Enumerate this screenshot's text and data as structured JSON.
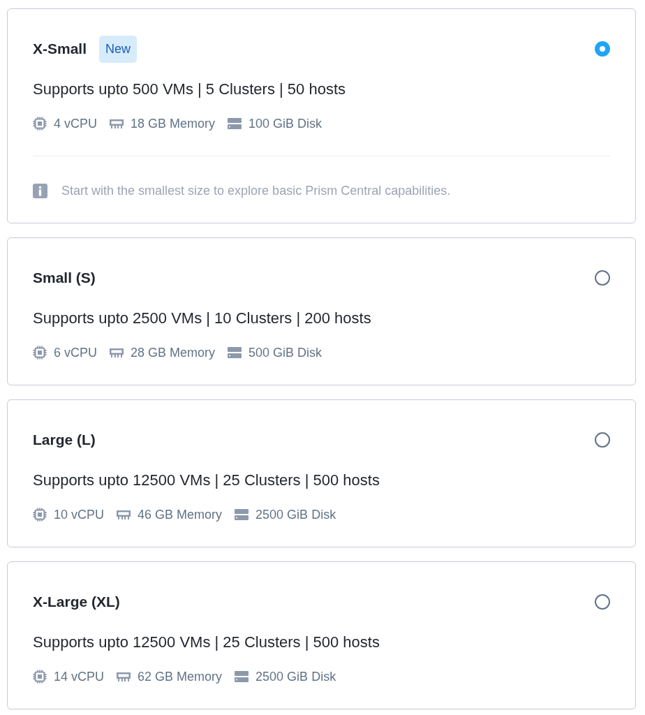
{
  "options": [
    {
      "title": "X-Small",
      "badge": "New",
      "selected": true,
      "capacity": "Supports upto 500 VMs | 5 Clusters | 50 hosts",
      "specs": [
        {
          "kind": "cpu",
          "text": "4 vCPU"
        },
        {
          "kind": "memory",
          "text": "18 GB Memory"
        },
        {
          "kind": "disk",
          "text": "100 GiB Disk"
        }
      ],
      "note": "Start with the smallest size to explore basic Prism Central capabilities."
    },
    {
      "title": "Small (S)",
      "selected": false,
      "capacity": "Supports upto 2500 VMs | 10 Clusters | 200 hosts",
      "specs": [
        {
          "kind": "cpu",
          "text": "6 vCPU"
        },
        {
          "kind": "memory",
          "text": "28 GB Memory"
        },
        {
          "kind": "disk",
          "text": "500 GiB Disk"
        }
      ]
    },
    {
      "title": "Large (L)",
      "selected": false,
      "capacity": "Supports upto 12500 VMs | 25 Clusters | 500 hosts",
      "specs": [
        {
          "kind": "cpu",
          "text": "10 vCPU"
        },
        {
          "kind": "memory",
          "text": "46 GB Memory"
        },
        {
          "kind": "disk",
          "text": "2500 GiB Disk"
        }
      ]
    },
    {
      "title": "X-Large (XL)",
      "selected": false,
      "capacity": "Supports upto 12500 VMs | 25 Clusters | 500 hosts",
      "specs": [
        {
          "kind": "cpu",
          "text": "14 vCPU"
        },
        {
          "kind": "memory",
          "text": "62 GB Memory"
        },
        {
          "kind": "disk",
          "text": "2500 GiB Disk"
        }
      ]
    }
  ]
}
